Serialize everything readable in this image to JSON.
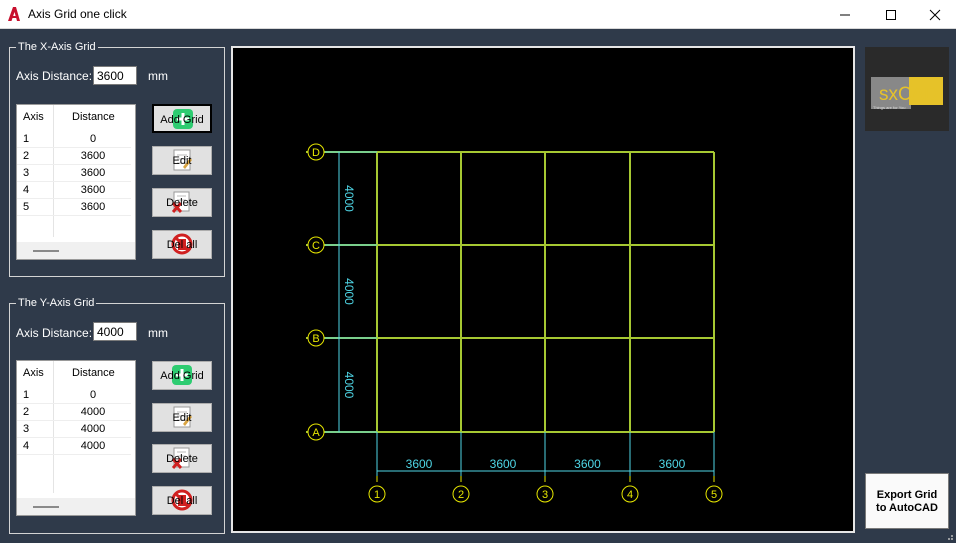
{
  "window": {
    "title": "Axis Grid one click",
    "icon": "autocad-a-icon",
    "controls": [
      "minimize-icon",
      "maximize-icon",
      "close-icon"
    ]
  },
  "x_group": {
    "legend": "The X-Axis Grid",
    "distance_label": "Axis Distance:",
    "distance_value": "3600",
    "unit": "mm",
    "columns": [
      "Axis",
      "Distance"
    ],
    "rows": [
      {
        "axis": "1",
        "distance": "0"
      },
      {
        "axis": "2",
        "distance": "3600"
      },
      {
        "axis": "3",
        "distance": "3600"
      },
      {
        "axis": "4",
        "distance": "3600"
      },
      {
        "axis": "5",
        "distance": "3600"
      }
    ],
    "buttons": {
      "add": "Add Grid",
      "edit": "Edit",
      "delete": "Delete",
      "delete_all": "Del all"
    }
  },
  "y_group": {
    "legend": "The Y-Axis Grid",
    "distance_label": "Axis Distance:",
    "distance_value": "4000",
    "unit": "mm",
    "columns": [
      "Axis",
      "Distance"
    ],
    "rows": [
      {
        "axis": "1",
        "distance": "0"
      },
      {
        "axis": "2",
        "distance": "4000"
      },
      {
        "axis": "3",
        "distance": "4000"
      },
      {
        "axis": "4",
        "distance": "4000"
      }
    ],
    "buttons": {
      "add": "Add Grid",
      "edit": "Edit",
      "delete": "Delete",
      "delete_all": "Del all"
    }
  },
  "drawing": {
    "x_axes": [
      "1",
      "2",
      "3",
      "4",
      "5"
    ],
    "x_spacings": [
      "3600",
      "3600",
      "3600",
      "3600"
    ],
    "y_axes": [
      "A",
      "B",
      "C",
      "D"
    ],
    "y_spacings": [
      "4000",
      "4000",
      "4000"
    ],
    "colors": {
      "grid": "#a6c832",
      "dimension": "#4fd6e6",
      "bubble": "#e6e600",
      "background": "#000000"
    }
  },
  "logo": {
    "text": "sxCAD",
    "tagline": "Things are for You"
  },
  "export_button": {
    "line1": "Export Grid",
    "line2": "to AutoCAD"
  }
}
